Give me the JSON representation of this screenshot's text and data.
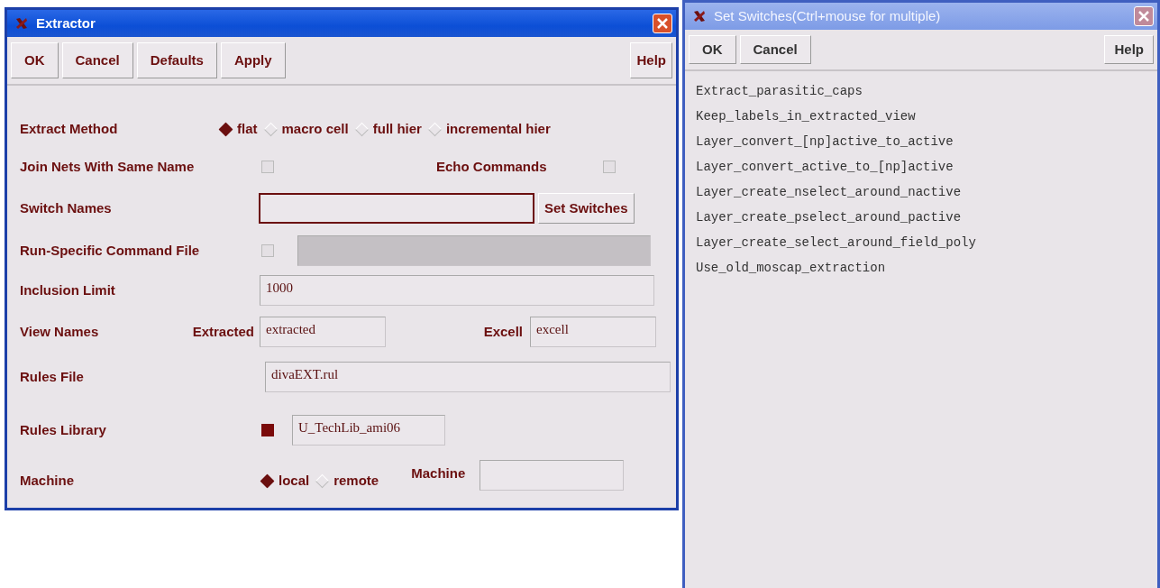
{
  "extractor": {
    "title": "Extractor",
    "buttons": [
      "OK",
      "Cancel",
      "Defaults",
      "Apply"
    ],
    "help": "Help",
    "extract_method": {
      "label": "Extract Method",
      "options": [
        {
          "label": "flat",
          "selected": true
        },
        {
          "label": "macro cell",
          "selected": false
        },
        {
          "label": "full hier",
          "selected": false
        },
        {
          "label": "incremental hier",
          "selected": false
        }
      ]
    },
    "join_nets": {
      "label": "Join Nets With Same Name",
      "checked": false
    },
    "echo_commands": {
      "label": "Echo Commands",
      "checked": false
    },
    "switch_names": {
      "label": "Switch Names",
      "focused": true,
      "button": "Set Switches"
    },
    "run_specific": {
      "label": "Run-Specific Command File",
      "checked": false,
      "field_disabled": true
    },
    "inclusion_limit": {
      "label": "Inclusion Limit",
      "value": "1000"
    },
    "view_names": {
      "label": "View Names",
      "extracted_label": "Extracted",
      "extracted": "extracted",
      "excell_label": "Excell",
      "excell": "excell"
    },
    "rules_file": {
      "label": "Rules File",
      "value": "divaEXT.rul"
    },
    "rules_library": {
      "label": "Rules Library",
      "checked": true,
      "value": "U_TechLib_ami06"
    },
    "machine": {
      "label": "Machine",
      "options": [
        {
          "label": "local",
          "selected": true
        },
        {
          "label": "remote",
          "selected": false
        }
      ],
      "machine_label": "Machine"
    }
  },
  "switches": {
    "title": "Set Switches(Ctrl+mouse for multiple)",
    "buttons": [
      "OK",
      "Cancel"
    ],
    "help": "Help",
    "items": [
      {
        "label": "Extract_parasitic_caps",
        "selected": false
      },
      {
        "label": "Keep_labels_in_extracted_view",
        "selected": false
      },
      {
        "label": "Layer_convert_[np]active_to_active",
        "selected": false
      },
      {
        "label": "Layer_convert_active_to_[np]active",
        "selected": false
      },
      {
        "label": "Layer_create_nselect_around_nactive",
        "selected": false
      },
      {
        "label": "Layer_create_pselect_around_pactive",
        "selected": false
      },
      {
        "label": "Layer_create_select_around_field_poly",
        "selected": false
      },
      {
        "label": "Use_old_moscap_extraction",
        "selected": false
      }
    ]
  }
}
